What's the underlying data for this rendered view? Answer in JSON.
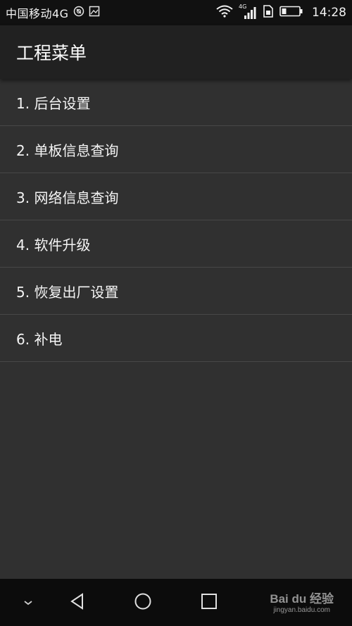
{
  "status_bar": {
    "carrier": "中国移动4G",
    "network_label": "4G",
    "time": "14:28",
    "icons": [
      "no-disturb-icon",
      "image-notification-icon",
      "wifi-icon",
      "signal-icon",
      "sim-icon",
      "battery-icon"
    ]
  },
  "app_bar": {
    "title": "工程菜单"
  },
  "menu": {
    "items": [
      {
        "label": "1. 后台设置"
      },
      {
        "label": "2. 单板信息查询"
      },
      {
        "label": "3. 网络信息查询"
      },
      {
        "label": "4. 软件升级"
      },
      {
        "label": "5. 恢复出厂设置"
      },
      {
        "label": "6. 补电"
      }
    ]
  },
  "nav_bar": {
    "buttons": [
      "collapse-icon",
      "back-icon",
      "home-icon",
      "recents-icon"
    ]
  },
  "watermark": {
    "logo": "Bai du 经验",
    "url": "jingyan.baidu.com"
  },
  "colors": {
    "background": "#303030",
    "app_bar": "#212121",
    "status_bar": "#111111",
    "nav_bar": "#0c0c0c",
    "divider": "#474747"
  }
}
